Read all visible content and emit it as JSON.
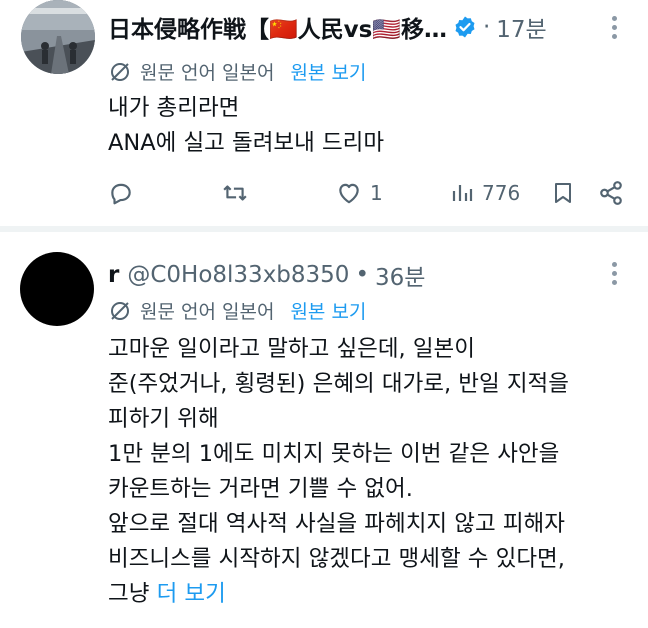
{
  "posts": [
    {
      "name": "日本侵略作戦【🇨🇳人民vs🇺🇸移…",
      "time": "17분",
      "translation": {
        "label": "원문 언어 일본어",
        "view_original": "원본 보기"
      },
      "text": "내가 총리라면\nANA에 실고 돌려보내 드리마",
      "actions": {
        "likes": "1",
        "views": "776"
      }
    },
    {
      "name": "r",
      "handle": "@C0Ho8l33xb8350",
      "time": "36분",
      "translation": {
        "label": "원문 언어 일본어",
        "view_original": "원본 보기"
      },
      "text": "고마운 일이라고 말하고 싶은데, 일본이\n준(주었거나, 횡령된) 은혜의 대가로, 반일 지적을\n피하기 위해\n1만 분의 1에도 미치지 못하는 이번 같은 사안을\n카운트하는 거라면 기쁠 수 없어.\n앞으로 절대 역사적 사실을 파헤치지 않고 피해자\n비즈니스를 시작하지 않겠다고 맹세할 수 있다면,\n그냥 ",
      "more_label": "더 보기"
    }
  ],
  "colors": {
    "accent": "#1d9bf0",
    "muted": "#536471",
    "verified": "#1d9bf0"
  },
  "icons": [
    "translate-icon",
    "reply-icon",
    "repost-icon",
    "like-icon",
    "views-icon",
    "bookmark-icon",
    "share-icon",
    "more-icon",
    "verified-icon"
  ]
}
